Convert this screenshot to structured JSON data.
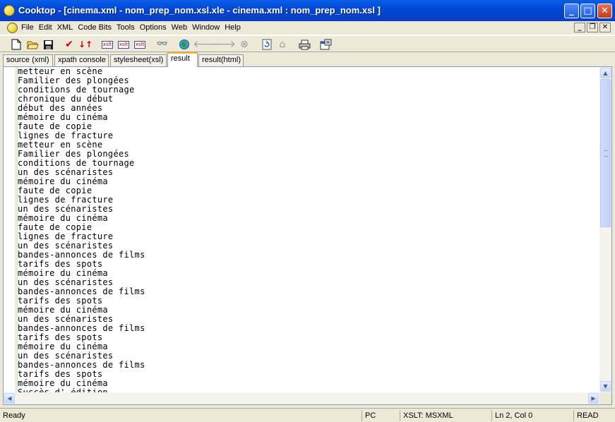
{
  "window": {
    "title": "Cooktop - [cinema.xml - nom_prep_nom.xsl.xle - cinema.xml : nom_prep_nom.xsl ]",
    "minimize_icon": "minimize-icon",
    "maximize_icon": "maximize-icon",
    "close_icon": "close-icon"
  },
  "menu": {
    "items": [
      "File",
      "Edit",
      "XML",
      "Code Bits",
      "Tools",
      "Options",
      "Web",
      "Window",
      "Help"
    ]
  },
  "toolbar": {
    "xslt_label": "xslt"
  },
  "tabs": [
    {
      "label": "source (xml)",
      "active": false
    },
    {
      "label": "xpath console",
      "active": false
    },
    {
      "label": "stylesheet(xsl)",
      "active": false
    },
    {
      "label": "result",
      "active": true
    },
    {
      "label": "result(html)",
      "active": false
    }
  ],
  "editor": {
    "lines": [
      "metteur en scène",
      "Familier des plongées",
      "conditions de tournage",
      "chronique du début",
      "début des années",
      "mémoire du cinéma",
      "faute de copie",
      "lignes de fracture",
      "metteur en scène",
      "Familier des plongées",
      "conditions de tournage",
      "un des scénaristes",
      "mémoire du cinéma",
      "faute de copie",
      "lignes de fracture",
      "un des scénaristes",
      "mémoire du cinéma",
      "faute de copie",
      "lignes de fracture",
      "un des scénaristes",
      "bandes-annonces de films",
      "tarifs des spots",
      "mémoire du cinéma",
      "un des scénaristes",
      "bandes-annonces de films",
      "tarifs des spots",
      "mémoire du cinéma",
      "un des scénaristes",
      "bandes-annonces de films",
      "tarifs des spots",
      "mémoire du cinéma",
      "un des scénaristes",
      "bandes-annonces de films",
      "tarifs des spots",
      "mémoire du cinéma",
      "Succès d' édition"
    ]
  },
  "status": {
    "message": "Ready",
    "mode": "PC",
    "processor": "XSLT: MSXML",
    "position": "Ln 2, Col 0",
    "access": "READ"
  }
}
